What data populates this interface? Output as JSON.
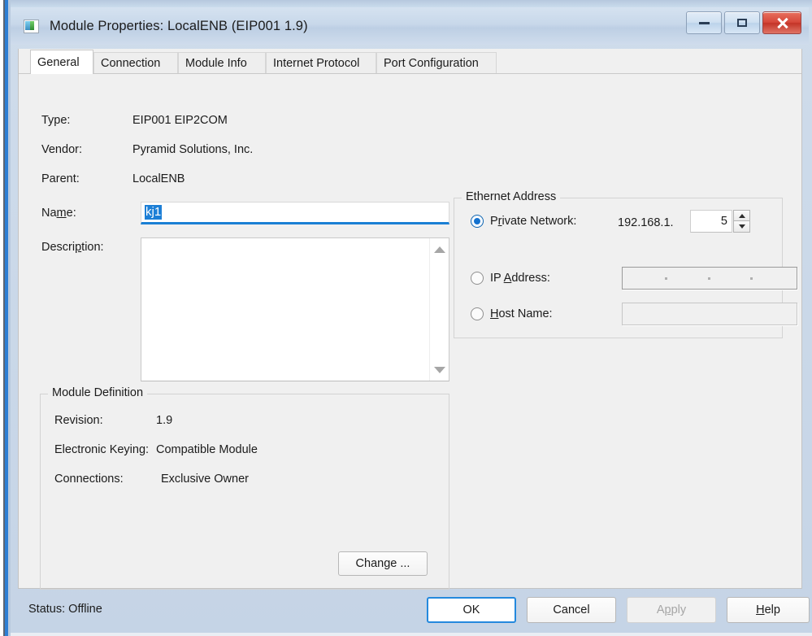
{
  "window": {
    "title": "Module Properties: LocalENB (EIP001 1.9)",
    "icon": "module-icon",
    "controls": {
      "minimize": "minimize-icon",
      "maximize": "maximize-icon",
      "close": "close-icon"
    },
    "accent_color": "#1a7fd4",
    "close_color": "#d6473a"
  },
  "tabs": [
    {
      "label": "General",
      "active": true
    },
    {
      "label": "Connection",
      "active": false
    },
    {
      "label": "Module Info",
      "active": false
    },
    {
      "label": "Internet Protocol",
      "active": false
    },
    {
      "label": "Port Configuration",
      "active": false
    }
  ],
  "general": {
    "type_label": "Type:",
    "type_value": "EIP001 EIP2COM",
    "vendor_label": "Vendor:",
    "vendor_value": "Pyramid Solutions, Inc.",
    "parent_label": "Parent:",
    "parent_value": "LocalENB",
    "name_label_pre": "Na",
    "name_label_accel": "m",
    "name_label_post": "e:",
    "name_value": "kj1",
    "description_label_pre": "Descri",
    "description_label_accel": "p",
    "description_label_post": "tion:",
    "description_value": "",
    "scroll_up_icon": "scroll-up-arrow-icon",
    "scroll_down_icon": "scroll-down-arrow-icon"
  },
  "ethernet": {
    "group_title": "Ethernet Address",
    "private_network": {
      "label_pre": "P",
      "label_accel": "r",
      "label_post": "ivate Network:",
      "selected": true,
      "prefix": "192.168.1.",
      "octet": "5",
      "spin_up_icon": "spinner-up-icon",
      "spin_down_icon": "spinner-down-icon"
    },
    "ip_address": {
      "label_pre": "IP ",
      "label_accel": "A",
      "label_post": "ddress:",
      "selected": false,
      "value": ""
    },
    "host_name": {
      "label_pre": "",
      "label_accel": "H",
      "label_post": "ost Name:",
      "selected": false,
      "value": ""
    }
  },
  "module_definition": {
    "group_title": "Module Definition",
    "revision_label": "Revision:",
    "revision_value": "1.9",
    "keying_label": "Electronic Keying:",
    "keying_value": "Compatible Module",
    "connections_label": "Connections:",
    "connections_value": "Exclusive Owner",
    "change_button_pre": "Chan",
    "change_button_accel": "g",
    "change_button_post": "e ..."
  },
  "footer": {
    "status": "Status:  Offline",
    "ok": "OK",
    "cancel": "Cancel",
    "apply_pre": "A",
    "apply_accel": "p",
    "apply_post": "ply",
    "apply_enabled": false,
    "help_pre": "",
    "help_accel": "H",
    "help_post": "elp"
  }
}
